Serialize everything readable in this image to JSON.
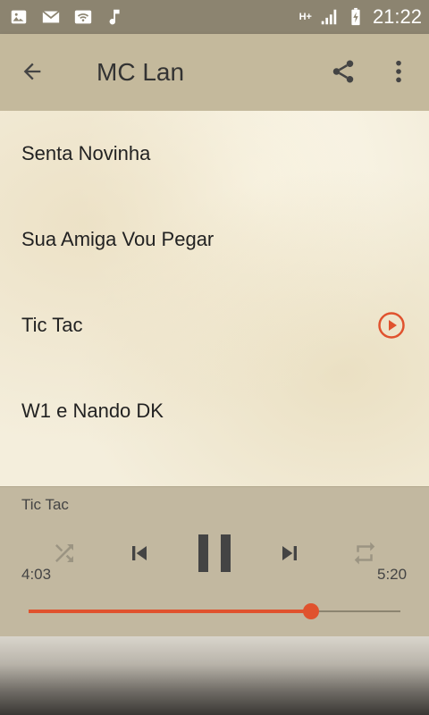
{
  "status_bar": {
    "time": "21:22",
    "network": "H+",
    "icons": [
      "image-icon",
      "mail-icon",
      "wifi-icon",
      "music-note-icon",
      "signal-icon",
      "battery-charging-icon"
    ]
  },
  "app_bar": {
    "title": "MC Lan",
    "back_icon": "arrow-back-icon",
    "share_icon": "share-icon",
    "more_icon": "more-vert-icon"
  },
  "songs": [
    {
      "title": "Senta Novinha",
      "playing": false
    },
    {
      "title": "Sua Amiga Vou Pegar",
      "playing": false
    },
    {
      "title": "Tic Tac",
      "playing": true
    },
    {
      "title": "W1 e Nando DK",
      "playing": false
    }
  ],
  "player": {
    "now_playing": "Tic Tac",
    "current_time": "4:03",
    "total_time": "5:20",
    "progress": 0.76,
    "controls": [
      "shuffle-icon",
      "skip-previous-icon",
      "pause-icon",
      "skip-next-icon",
      "repeat-icon"
    ]
  },
  "colors": {
    "accent": "#e0522e",
    "app_bar": "#c4b99c",
    "status_bar": "#8c8470",
    "player_bg": "#c2b8a0"
  }
}
